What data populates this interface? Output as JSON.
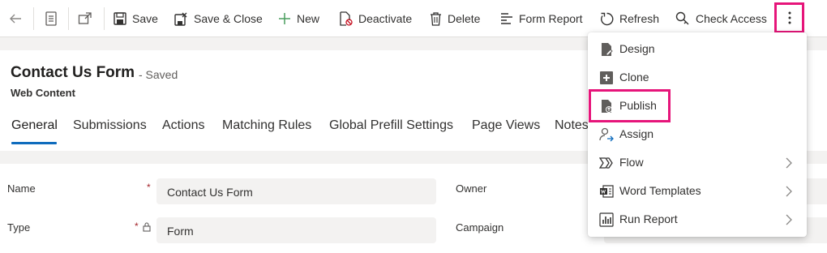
{
  "toolbar": {
    "back_label": "",
    "save_label": "Save",
    "save_close_label": "Save & Close",
    "new_label": "New",
    "deactivate_label": "Deactivate",
    "delete_label": "Delete",
    "form_report_label": "Form Report",
    "refresh_label": "Refresh",
    "check_access_label": "Check Access"
  },
  "header": {
    "title": "Contact Us Form",
    "status": "- Saved",
    "entity": "Web Content"
  },
  "tabs": [
    {
      "label": "General"
    },
    {
      "label": "Submissions"
    },
    {
      "label": "Actions"
    },
    {
      "label": "Matching Rules"
    },
    {
      "label": "Global Prefill Settings"
    },
    {
      "label": "Page Views"
    },
    {
      "label": "Notes"
    }
  ],
  "form": {
    "name_label": "Name",
    "name_value": "Contact Us Form",
    "type_label": "Type",
    "type_value": "Form",
    "owner_label": "Owner",
    "campaign_label": "Campaign",
    "required_mark": "*"
  },
  "menu": {
    "items": [
      {
        "label": "Design",
        "icon": "design-icon"
      },
      {
        "label": "Clone",
        "icon": "clone-icon"
      },
      {
        "label": "Publish",
        "icon": "publish-icon"
      },
      {
        "label": "Assign",
        "icon": "assign-icon"
      },
      {
        "label": "Flow",
        "icon": "flow-icon"
      },
      {
        "label": "Word Templates",
        "icon": "word-templates-icon"
      },
      {
        "label": "Run Report",
        "icon": "run-report-icon"
      }
    ]
  },
  "colors": {
    "accent": "#0f6cbd",
    "highlight": "#e6157a",
    "required": "#a4262c"
  }
}
